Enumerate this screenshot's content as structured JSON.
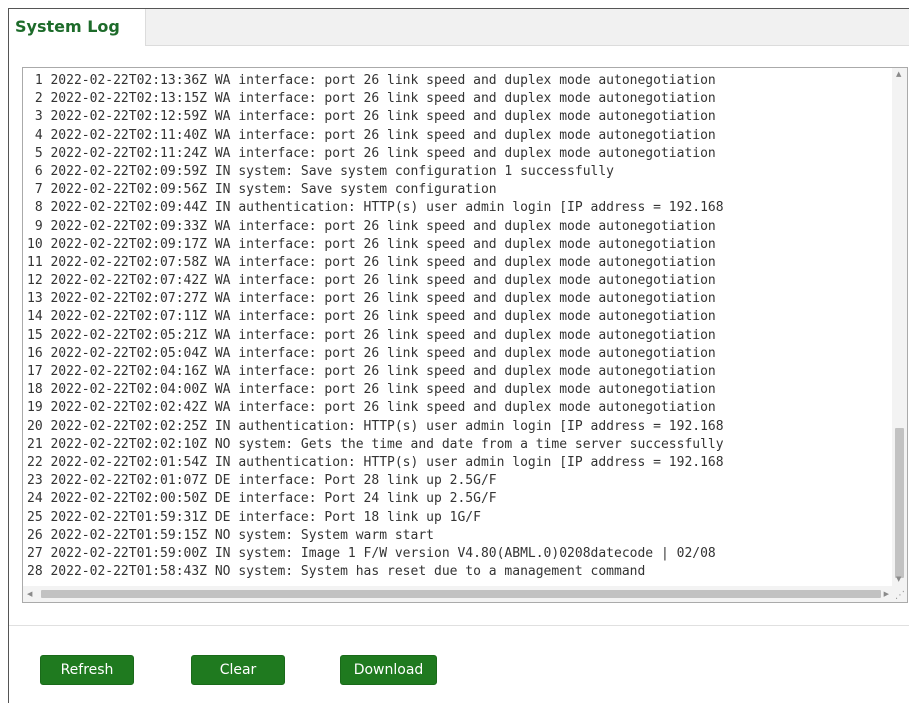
{
  "tab": {
    "label": "System Log"
  },
  "log_lines": [
    " 1 2022-02-22T02:13:36Z WA interface: port 26 link speed and duplex mode autonegotiation",
    " 2 2022-02-22T02:13:15Z WA interface: port 26 link speed and duplex mode autonegotiation",
    " 3 2022-02-22T02:12:59Z WA interface: port 26 link speed and duplex mode autonegotiation",
    " 4 2022-02-22T02:11:40Z WA interface: port 26 link speed and duplex mode autonegotiation",
    " 5 2022-02-22T02:11:24Z WA interface: port 26 link speed and duplex mode autonegotiation",
    " 6 2022-02-22T02:09:59Z IN system: Save system configuration 1 successfully",
    " 7 2022-02-22T02:09:56Z IN system: Save system configuration",
    " 8 2022-02-22T02:09:44Z IN authentication: HTTP(s) user admin login [IP address = 192.168",
    " 9 2022-02-22T02:09:33Z WA interface: port 26 link speed and duplex mode autonegotiation",
    "10 2022-02-22T02:09:17Z WA interface: port 26 link speed and duplex mode autonegotiation",
    "11 2022-02-22T02:07:58Z WA interface: port 26 link speed and duplex mode autonegotiation",
    "12 2022-02-22T02:07:42Z WA interface: port 26 link speed and duplex mode autonegotiation",
    "13 2022-02-22T02:07:27Z WA interface: port 26 link speed and duplex mode autonegotiation",
    "14 2022-02-22T02:07:11Z WA interface: port 26 link speed and duplex mode autonegotiation",
    "15 2022-02-22T02:05:21Z WA interface: port 26 link speed and duplex mode autonegotiation",
    "16 2022-02-22T02:05:04Z WA interface: port 26 link speed and duplex mode autonegotiation",
    "17 2022-02-22T02:04:16Z WA interface: port 26 link speed and duplex mode autonegotiation",
    "18 2022-02-22T02:04:00Z WA interface: port 26 link speed and duplex mode autonegotiation",
    "19 2022-02-22T02:02:42Z WA interface: port 26 link speed and duplex mode autonegotiation",
    "20 2022-02-22T02:02:25Z IN authentication: HTTP(s) user admin login [IP address = 192.168",
    "21 2022-02-22T02:02:10Z NO system: Gets the time and date from a time server successfully",
    "22 2022-02-22T02:01:54Z IN authentication: HTTP(s) user admin login [IP address = 192.168",
    "23 2022-02-22T02:01:07Z DE interface: Port 28 link up 2.5G/F",
    "24 2022-02-22T02:00:50Z DE interface: Port 24 link up 2.5G/F",
    "25 2022-02-22T01:59:31Z DE interface: Port 18 link up 1G/F",
    "26 2022-02-22T01:59:15Z NO system: System warm start",
    "27 2022-02-22T01:59:00Z IN system: Image 1 F/W version V4.80(ABML.0)0208datecode | 02/08",
    "28 2022-02-22T01:58:43Z NO system: System has reset due to a management command"
  ],
  "buttons": {
    "refresh": "Refresh",
    "clear": "Clear",
    "download": "Download"
  },
  "icons": {
    "scroll_up": "scroll-up-arrow-icon",
    "scroll_down": "scroll-down-arrow-icon",
    "scroll_left": "scroll-left-arrow-icon",
    "scroll_right": "scroll-right-arrow-icon",
    "resize_grip": "resize-grip-icon"
  },
  "colors": {
    "accent": "#1d6b2a",
    "button_bg": "#1f7a1f",
    "button_text": "#ffffff"
  }
}
